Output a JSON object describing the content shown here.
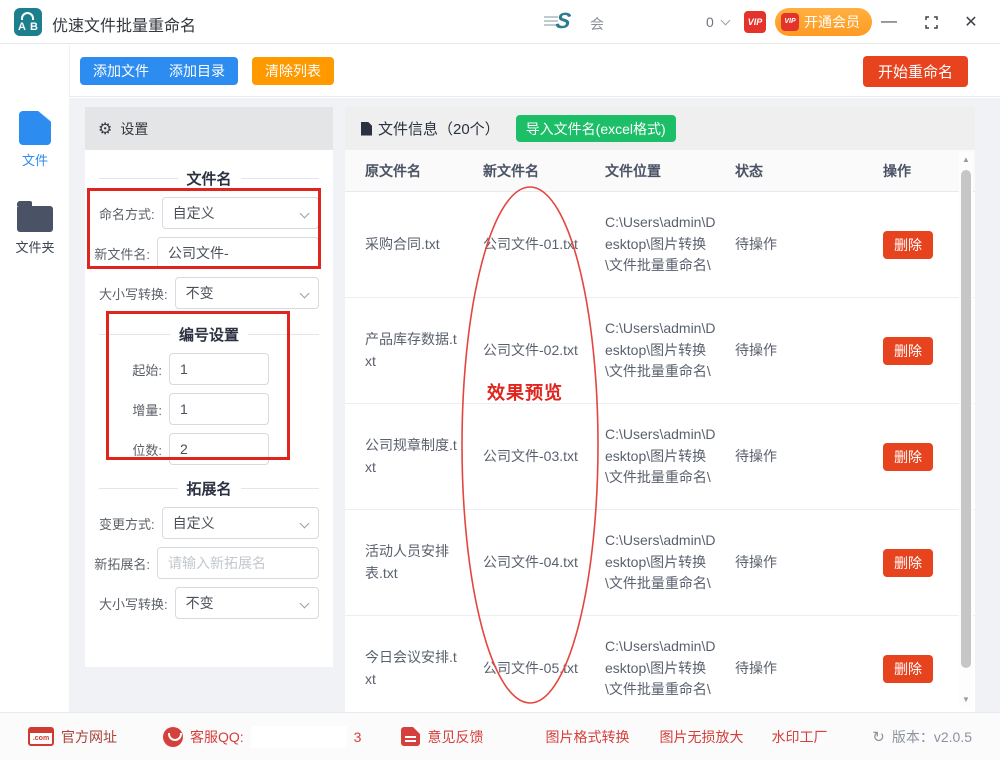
{
  "titlebar": {
    "logo_a": "A",
    "logo_b": "B",
    "app_title": "优速文件批量重命名",
    "brand_s": "S",
    "member_fragment": "会",
    "account_fragment": "0",
    "vip_text": "VIP",
    "upgrade_button": "开通会员",
    "minimize_icon": "—",
    "close_icon": "✕"
  },
  "toolbar": {
    "add_files": "添加文件",
    "add_folder": "添加目录",
    "clear_list": "清除列表",
    "start_rename": "开始重命名"
  },
  "sidebar": {
    "items": [
      {
        "label": "文件"
      },
      {
        "label": "文件夹"
      }
    ]
  },
  "settings": {
    "header": "设置",
    "filename_section": {
      "title": "文件名",
      "naming_label": "命名方式:",
      "naming_value": "自定义",
      "newname_label": "新文件名:",
      "newname_value": "公司文件-",
      "case_label": "大小写转换:",
      "case_value": "不变"
    },
    "number_section": {
      "title": "编号设置",
      "start_label": "起始:",
      "start_value": "1",
      "step_label": "增量:",
      "step_value": "1",
      "digits_label": "位数:",
      "digits_value": "2"
    },
    "ext_section": {
      "title": "拓展名",
      "mode_label": "变更方式:",
      "mode_value": "自定义",
      "newext_label": "新拓展名:",
      "newext_placeholder": "请输入新拓展名",
      "case_label": "大小写转换:",
      "case_value": "不变"
    }
  },
  "files": {
    "title": "文件信息（20个）",
    "import_button": "导入文件名(excel格式)",
    "columns": [
      "原文件名",
      "新文件名",
      "文件位置",
      "状态",
      "操作"
    ],
    "rows": [
      {
        "original": "采购合同.txt",
        "new_name": "公司文件-01.txt",
        "location": "C:\\Users\\admin\\Desktop\\图片转换\\文件批量重命名\\",
        "status": "待操作",
        "action": "删除"
      },
      {
        "original": "产品库存数据.txt",
        "new_name": "公司文件-02.txt",
        "location": "C:\\Users\\admin\\Desktop\\图片转换\\文件批量重命名\\",
        "status": "待操作",
        "action": "删除"
      },
      {
        "original": "公司规章制度.txt",
        "new_name": "公司文件-03.txt",
        "location": "C:\\Users\\admin\\Desktop\\图片转换\\文件批量重命名\\",
        "status": "待操作",
        "action": "删除"
      },
      {
        "original": "活动人员安排表.txt",
        "new_name": "公司文件-04.txt",
        "location": "C:\\Users\\admin\\Desktop\\图片转换\\文件批量重命名\\",
        "status": "待操作",
        "action": "删除"
      },
      {
        "original": "今日会议安排.txt",
        "new_name": "公司文件-05.txt",
        "location": "C:\\Users\\admin\\Desktop\\图片转换\\文件批量重命名\\",
        "status": "待操作",
        "action": "删除"
      }
    ]
  },
  "annotation": {
    "preview_label": "效果预览"
  },
  "statusbar": {
    "com_icon_text": ".com",
    "official_site": "官方网址",
    "qq_label": "客服QQ:",
    "qq_fragment": "3",
    "feedback": "意见反馈",
    "link_format": "图片格式转换",
    "link_upscale": "图片无损放大",
    "link_watermark": "水印工厂",
    "refresh_icon": "↻",
    "version": "版本：v2.0.5"
  },
  "colors": {
    "primary_blue": "#2d8cf0",
    "orange": "#ff9900",
    "action_red": "#e8431f",
    "green": "#1dbe68",
    "annotation_red": "#e2241f"
  }
}
